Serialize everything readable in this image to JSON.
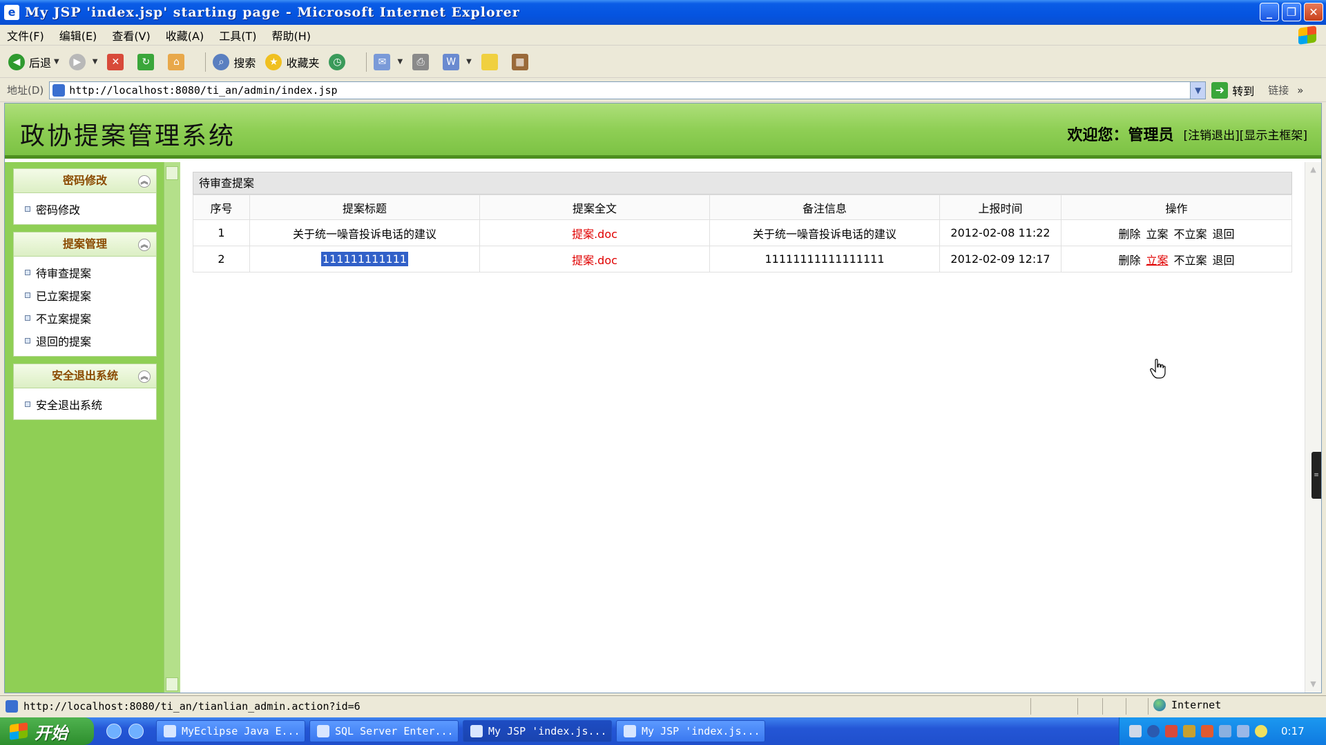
{
  "window": {
    "title": "My JSP 'index.jsp' starting page - Microsoft Internet Explorer"
  },
  "menu": {
    "items": [
      "文件(F)",
      "编辑(E)",
      "查看(V)",
      "收藏(A)",
      "工具(T)",
      "帮助(H)"
    ]
  },
  "toolbar": {
    "back": "后退",
    "search": "搜索",
    "favorites": "收藏夹"
  },
  "address": {
    "label": "地址(D)",
    "url": "http://localhost:8080/ti_an/admin/index.jsp",
    "go": "转到",
    "links": "链接"
  },
  "app": {
    "title": "政协提案管理系统",
    "welcome_label": "欢迎您：",
    "user": "管理员",
    "logout": "[注销退出]",
    "show_frame": "[显示主框架]"
  },
  "sidebar": {
    "groups": [
      {
        "title": "密码修改",
        "items": [
          "密码修改"
        ]
      },
      {
        "title": "提案管理",
        "items": [
          "待审查提案",
          "已立案提案",
          "不立案提案",
          "退回的提案"
        ]
      },
      {
        "title": "安全退出系统",
        "items": [
          "安全退出系统"
        ]
      }
    ]
  },
  "panel": {
    "title": "待审查提案",
    "columns": [
      "序号",
      "提案标题",
      "提案全文",
      "备注信息",
      "上报时间",
      "操作"
    ],
    "rows": [
      {
        "no": "1",
        "title": "关于统一噪音投诉电话的建议",
        "doc": "提案.doc",
        "note": "关于统一噪音投诉电话的建议",
        "time": "2012-02-08 11:22"
      },
      {
        "no": "2",
        "title": "111111111111",
        "doc": "提案.doc",
        "note": "11111111111111111",
        "time": "2012-02-09 12:17"
      }
    ],
    "ops": [
      "删除",
      "立案",
      "不立案",
      "退回"
    ]
  },
  "status": {
    "url": "http://localhost:8080/ti_an/tianlian_admin.action?id=6",
    "zone": "Internet"
  },
  "taskbar": {
    "start": "开始",
    "tasks": [
      "MyEclipse Java E...",
      "SQL Server Enter...",
      "My JSP 'index.js...",
      "My JSP 'index.js..."
    ],
    "clock": "0:17"
  }
}
